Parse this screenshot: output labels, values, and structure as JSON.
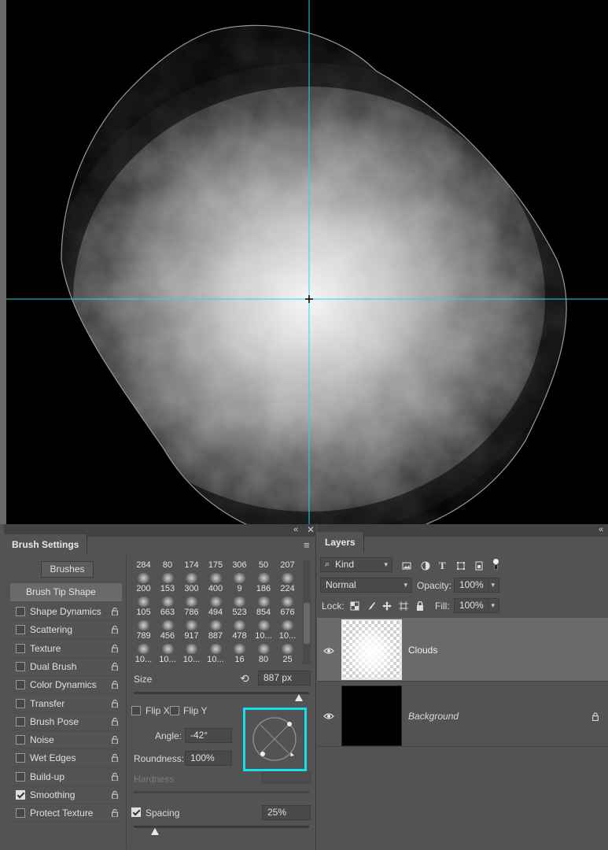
{
  "canvas": {
    "description_hidden": true,
    "guide_color": "#13e0e8"
  },
  "brush_settings": {
    "tab_title": "Brush Settings",
    "brushes_button": "Brushes",
    "tip_shape_label": "Brush Tip Shape",
    "options": [
      {
        "label": "Shape Dynamics",
        "checked": false
      },
      {
        "label": "Scattering",
        "checked": false
      },
      {
        "label": "Texture",
        "checked": false
      },
      {
        "label": "Dual Brush",
        "checked": false
      },
      {
        "label": "Color Dynamics",
        "checked": false
      },
      {
        "label": "Transfer",
        "checked": false
      },
      {
        "label": "Brush Pose",
        "checked": false
      },
      {
        "label": "Noise",
        "checked": false
      },
      {
        "label": "Wet Edges",
        "checked": false
      },
      {
        "label": "Build-up",
        "checked": false
      },
      {
        "label": "Smoothing",
        "checked": true
      },
      {
        "label": "Protect Texture",
        "checked": false
      }
    ],
    "brush_grid": [
      [
        "284",
        "80",
        "174",
        "175",
        "306",
        "50",
        "207"
      ],
      [
        "200",
        "153",
        "300",
        "400",
        "9",
        "186",
        "224"
      ],
      [
        "105",
        "663",
        "786",
        "494",
        "523",
        "854",
        "676"
      ],
      [
        "789",
        "456",
        "917",
        "887",
        "478",
        "10...",
        "10..."
      ],
      [
        "10...",
        "10...",
        "10...",
        "10...",
        "16",
        "80",
        "25"
      ]
    ],
    "size_label": "Size",
    "size_value": "887 px",
    "size_slider_fraction": 0.94,
    "flip_x_label": "Flip X",
    "flip_y_label": "Flip Y",
    "angle_label": "Angle:",
    "angle_value": "-42°",
    "roundness_label": "Roundness:",
    "roundness_value": "100%",
    "hardness_label": "Hardness",
    "spacing_label": "Spacing",
    "spacing_checked": true,
    "spacing_value": "25%",
    "spacing_slider_fraction": 0.12
  },
  "layers": {
    "tab_title": "Layers",
    "filter_kind": "Kind",
    "blend_mode": "Normal",
    "opacity_label": "Opacity:",
    "opacity_value": "100%",
    "lock_label": "Lock:",
    "fill_label": "Fill:",
    "fill_value": "100%",
    "items": [
      {
        "name": "Clouds",
        "visible": true,
        "selected": true
      },
      {
        "name": "Background",
        "visible": true,
        "selected": false,
        "locked": true
      }
    ]
  }
}
